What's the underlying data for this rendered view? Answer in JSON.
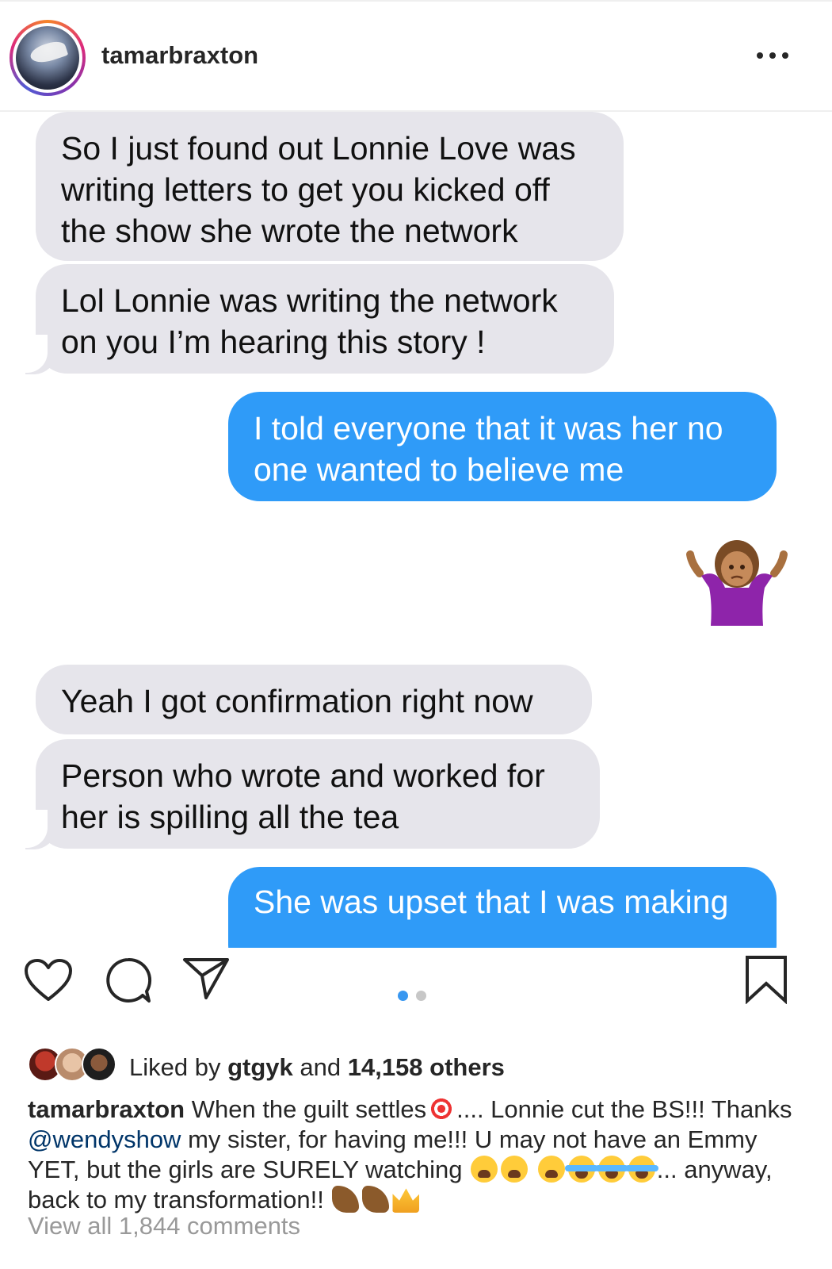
{
  "header": {
    "username": "tamarbraxton",
    "more_icon": "more-horizontal-icon"
  },
  "messages": [
    {
      "side": "in",
      "text": "So I just found out Lonnie Love was writing letters to get you kicked off the show she wrote the network"
    },
    {
      "side": "in",
      "text": "Lol Lonnie was writing the network on you I’m hearing this story !"
    },
    {
      "side": "out",
      "text": "I told everyone that it was her no one wanted to believe me"
    },
    {
      "side": "out",
      "emoji": "person-shrugging-emoji"
    },
    {
      "side": "in",
      "text": "Yeah I got confirmation right now"
    },
    {
      "side": "in",
      "text": "Person who wrote and worked for her is spilling all the tea"
    },
    {
      "side": "out",
      "text": "She was upset that I was making"
    }
  ],
  "actions": {
    "like_icon": "heart-icon",
    "comment_icon": "comment-icon",
    "share_icon": "paper-plane-icon",
    "save_icon": "bookmark-icon"
  },
  "pager": {
    "total": 2,
    "active": 1
  },
  "likes": {
    "prefix": "Liked by ",
    "user": "gtgyk",
    "middle": " and ",
    "others": "14,158 others"
  },
  "caption": {
    "user": "tamarbraxton",
    "part1": " When the guilt settles",
    "part2": ".... Lonnie cut the BS!!! Thanks ",
    "mention": "@wendyshow",
    "part3": " my sister, for having me!!! U may not have an Emmy YET, but the girls are SURELY watching ",
    "part4": "... anyway, back to my transformation!! "
  },
  "comments_link": "View all 1,844 comments",
  "colors": {
    "incoming_bubble": "#e6e5eb",
    "outgoing_bubble": "#2f9bf8",
    "mention": "#003569",
    "muted": "#999999",
    "pager_active": "#3897f0"
  }
}
